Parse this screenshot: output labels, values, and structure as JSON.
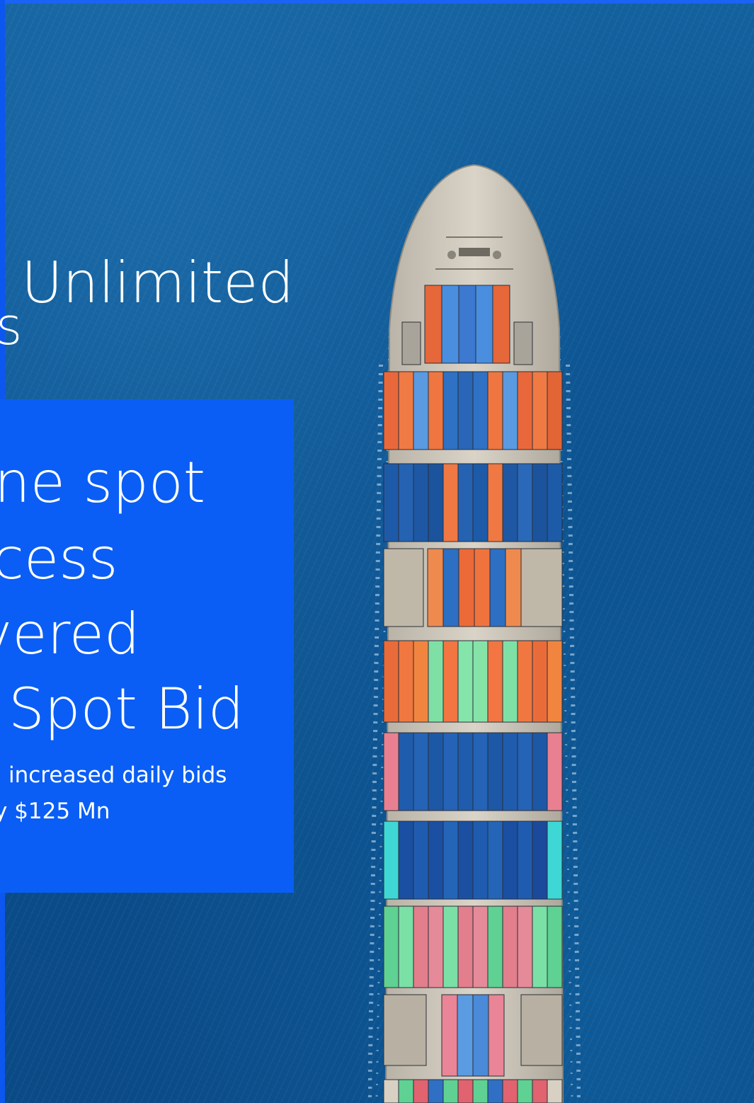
{
  "headline": {
    "text": "Unlimited",
    "fragment": "s"
  },
  "panel": {
    "lines": [
      "ne spot",
      "cess",
      "vered",
      "Spot Bid"
    ],
    "subtext": [
      "increased daily bids",
      "y $125 Mn"
    ]
  },
  "colors": {
    "panel": "#0a5ef5",
    "ocean": "#0a4a86",
    "text": "#ffffff"
  },
  "image": {
    "subject": "container-ship-aerial"
  }
}
